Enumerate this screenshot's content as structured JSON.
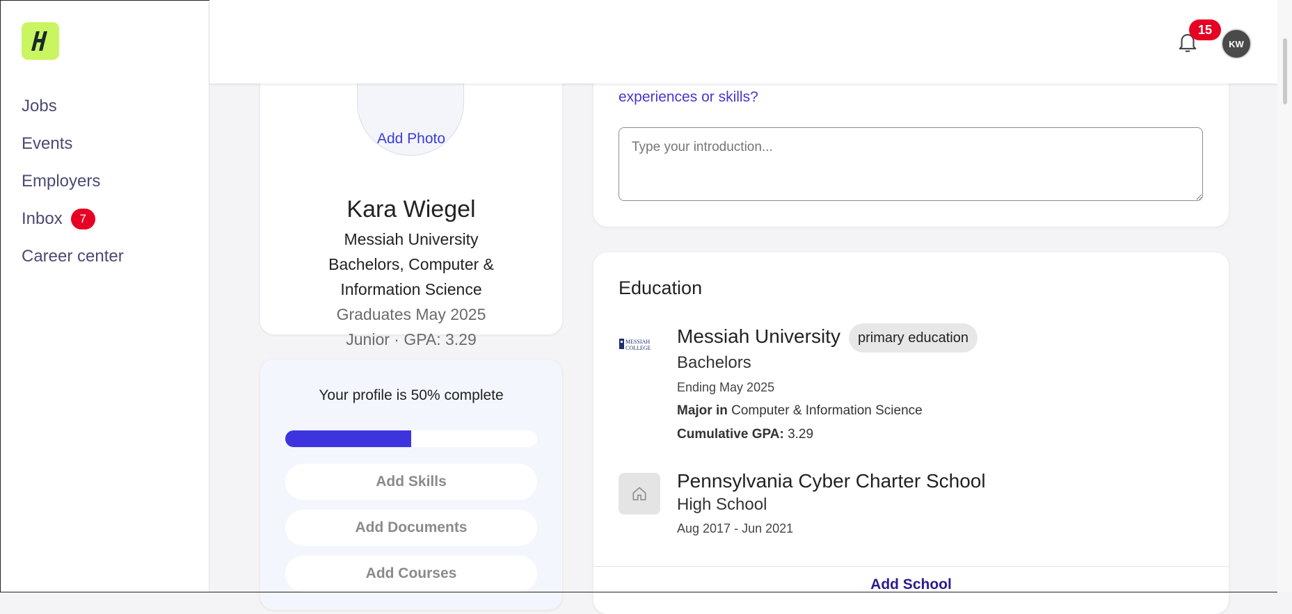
{
  "sidebar": {
    "logo_letter": "H",
    "items": [
      {
        "label": "Jobs"
      },
      {
        "label": "Events"
      },
      {
        "label": "Employers"
      },
      {
        "label": "Inbox",
        "badge": "7"
      },
      {
        "label": "Career center"
      }
    ]
  },
  "header": {
    "notification_count": "15",
    "avatar_initials": "KW"
  },
  "profile": {
    "add_photo": "Add Photo",
    "name": "Kara Wiegel",
    "school": "Messiah University",
    "degree_line1": "Bachelors, Computer &",
    "degree_line2": "Information Science",
    "graduation": "Graduates May 2025",
    "year_gpa": "Junior · GPA: 3.29"
  },
  "progress": {
    "title": "Your profile is 50% complete",
    "percent": 50,
    "buttons": [
      "Add Skills",
      "Add Documents",
      "Add Courses"
    ]
  },
  "intro": {
    "question_tail": "experiences or skills?",
    "placeholder": "Type your introduction..."
  },
  "education": {
    "title": "Education",
    "schools": [
      {
        "name": "Messiah University",
        "tag": "primary education",
        "logo_text": "MESSIAH COLLEGE",
        "degree": "Bachelors",
        "dates": "Ending May 2025",
        "major_label": "Major in",
        "major": "Computer & Information Science",
        "gpa_label": "Cumulative GPA:",
        "gpa": "3.29"
      },
      {
        "name": "Pennsylvania Cyber Charter School",
        "degree": "High School",
        "dates": "Aug 2017 - Jun 2021"
      }
    ],
    "add_school": "Add School"
  },
  "colors": {
    "accent": "#3d34e0",
    "logo_bg": "#c8f560",
    "badge_red": "#e60023",
    "nav_text": "#4a4a72",
    "link_purple": "#4a33d1"
  }
}
